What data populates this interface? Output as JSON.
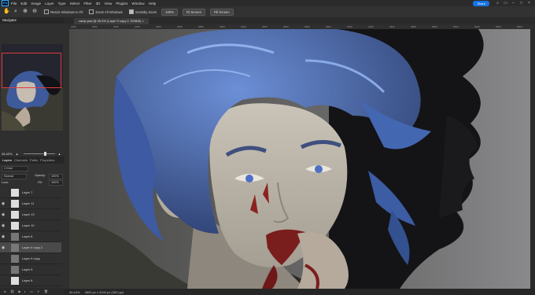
{
  "app": {
    "logo": "Ps",
    "menu": [
      "File",
      "Edit",
      "Image",
      "Layer",
      "Type",
      "Select",
      "Filter",
      "3D",
      "View",
      "Plugins",
      "Window",
      "Help"
    ],
    "share_label": "Share"
  },
  "options_bar": {
    "tools": [
      "hand-icon",
      "zoom-icon",
      "zoom-in-icon",
      "zoom-out-icon"
    ],
    "checkboxes": [
      {
        "label": "Resize Windows to Fit",
        "checked": false
      },
      {
        "label": "Zoom All Windows",
        "checked": false
      },
      {
        "label": "Scrubby Zoom",
        "checked": true
      }
    ],
    "buttons": [
      "100%",
      "Fit Screen",
      "Fill Screen"
    ]
  },
  "navigator": {
    "title": "Navigator",
    "zoom": "45.42%"
  },
  "document": {
    "tab_title": "vamp.psd @ 45.4% (Layer 9 copy 2, RGB/8)",
    "status_zoom": "45.44%",
    "status_info": "4800 px x 3240 px (300 ppi)"
  },
  "ruler": {
    "ticks": [
      "1600",
      "1800",
      "2000",
      "2200",
      "2400",
      "2600",
      "2800",
      "3000",
      "3200",
      "3400",
      "3600",
      "3800",
      "4000",
      "4200",
      "4400",
      "4600",
      "4800",
      "5000",
      "5200",
      "5400",
      "5600",
      "5800"
    ]
  },
  "layers_panel": {
    "tabs": [
      "Layers",
      "Channels",
      "Paths",
      "Properties"
    ],
    "kind_label": "Kind",
    "blend_mode": "Normal",
    "opacity_label": "Opacity:",
    "opacity_value": "100%",
    "lock_label": "Lock:",
    "fill_label": "Fill:",
    "fill_value": "100%",
    "layers": [
      {
        "name": "Layer 7",
        "visible": false,
        "selected": false
      },
      {
        "name": "Layer 11",
        "visible": true,
        "selected": false
      },
      {
        "name": "Layer 13",
        "visible": true,
        "selected": false
      },
      {
        "name": "Layer 10",
        "visible": true,
        "selected": false
      },
      {
        "name": "Layer 8",
        "visible": true,
        "selected": false
      },
      {
        "name": "Layer 9 copy 2",
        "visible": true,
        "selected": true
      },
      {
        "name": "Layer 9 copy",
        "visible": false,
        "selected": false
      },
      {
        "name": "Layer 9",
        "visible": false,
        "selected": false
      },
      {
        "name": "Layer 6",
        "visible": false,
        "selected": false
      }
    ],
    "footer": [
      "fx",
      "link-icon",
      "mask-icon",
      "adjust-icon",
      "folder-icon",
      "new-layer-icon",
      "trash-icon"
    ]
  },
  "colors": {
    "accent": "#1473e6",
    "nav_frame": "#e23c3c",
    "hair": "#4e74c4",
    "skin": "#b8b3a8",
    "blood": "#7a1d1d",
    "shadow": "#141416"
  }
}
